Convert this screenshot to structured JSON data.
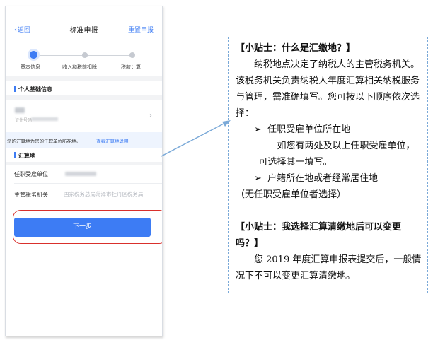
{
  "phone": {
    "nav": {
      "back": "返回",
      "title": "标准申报",
      "action": "重置申报"
    },
    "steps": [
      "基本信息",
      "收入和税前扣除",
      "税款计算"
    ],
    "personal_section": "个人基础信息",
    "id_label": "证件号码",
    "hint": {
      "text": "您的汇算地为您的任职单位所在地。",
      "link": "查看汇算地说明"
    },
    "settlement_section": "汇算地",
    "rows": [
      {
        "label": "任职受雇单位",
        "value": ""
      },
      {
        "label": "主管税务机关",
        "value": "国家税务总局菏泽市牡丹区税务局"
      }
    ],
    "next_button": "下一步"
  },
  "tips": [
    {
      "title": "【小贴士：什么是汇缴地？】",
      "intro": "纳税地点决定了纳税人的主管税务机关。该税务机关负责纳税人年度汇算相关纳税服务与管理，需准确填写。您可按以下顺序依次选择：",
      "bullet_marker": "➢",
      "options": [
        {
          "label": "任职受雇单位所在地",
          "detail": "如您有两处及以上任职受雇单位，可选择其一填写。"
        },
        {
          "label": "户籍所在地或者经常居住地",
          "detail": "（无任职受雇单位者选择）"
        }
      ]
    },
    {
      "title": "【小贴士：我选择汇算清缴地后可以变更吗？】",
      "body": "您 2019 年度汇算申报表提交后，一般情况下不可以变更汇算清缴地。"
    }
  ],
  "colors": {
    "accent": "#3d7cf4",
    "highlight": "#d9302c",
    "tip_border": "#7aa9d8"
  }
}
